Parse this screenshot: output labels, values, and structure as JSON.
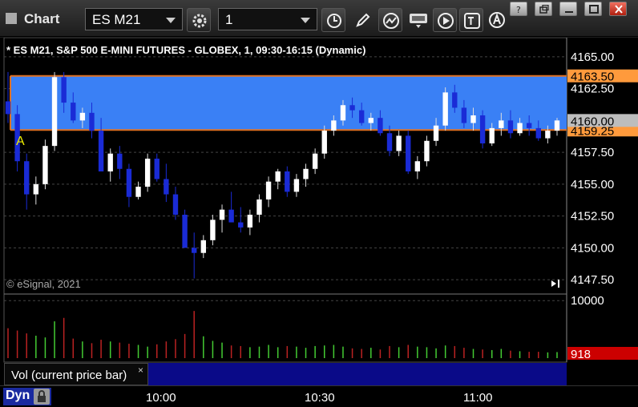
{
  "window": {
    "title": "Chart",
    "symbol": "ES M21",
    "interval": "1"
  },
  "chart": {
    "header": "* ES M21, S&P 500 E-MINI FUTURES - GLOBEX, 1, 09:30-16:15 (Dynamic)",
    "copyright": "© eSignal, 2021",
    "marker": "A",
    "price_axis": [
      "4165.00",
      "4162.50",
      "4157.50",
      "4155.00",
      "4152.50",
      "4150.00",
      "4147.50"
    ],
    "price_tags": {
      "upper": "4163.50",
      "last": "4160.00",
      "lower": "4159.25"
    },
    "volume_axis": "10000",
    "volume_tag": "918",
    "volume_study": "Vol (current price bar)",
    "volume_close": "×",
    "time_axis": [
      "10:00",
      "10:30",
      "11:00"
    ],
    "mode": "Dyn",
    "colors": {
      "up": "#ffffff",
      "down": "#1a2bd6",
      "band": "#3a80f5",
      "band_line": "#e07020",
      "tag": "#ff9a3c",
      "vol_up": "#44cc33",
      "vol_down": "#bb2222",
      "vol_tag": "#cc0000"
    }
  },
  "chart_data": {
    "type": "candlestick",
    "ylim": [
      4146.5,
      4166.5
    ],
    "band": [
      4159.25,
      4163.5
    ],
    "last": 4160.0,
    "candles": [
      [
        4161.5,
        4163.8,
        4159.8,
        4160.5
      ],
      [
        4160.5,
        4161.2,
        4156.0,
        4156.8
      ],
      [
        4156.8,
        4157.4,
        4153.0,
        4154.2
      ],
      [
        4154.2,
        4155.6,
        4153.4,
        4155.0
      ],
      [
        4155.0,
        4158.5,
        4154.6,
        4158.0
      ],
      [
        4158.0,
        4163.8,
        4157.6,
        4163.4
      ],
      [
        4163.4,
        4163.8,
        4160.6,
        4161.4
      ],
      [
        4161.4,
        4162.2,
        4159.8,
        4160.0
      ],
      [
        4160.0,
        4161.0,
        4159.4,
        4160.6
      ],
      [
        4160.6,
        4161.4,
        4158.6,
        4159.2
      ],
      [
        4159.2,
        4160.2,
        4156.4,
        4156.0
      ],
      [
        4156.0,
        4157.8,
        4155.2,
        4157.4
      ],
      [
        4157.4,
        4158.0,
        4155.4,
        4156.2
      ],
      [
        4156.2,
        4156.6,
        4153.2,
        4154.0
      ],
      [
        4154.0,
        4155.2,
        4153.8,
        4154.8
      ],
      [
        4154.8,
        4157.4,
        4154.4,
        4157.0
      ],
      [
        4157.0,
        4157.4,
        4155.2,
        4155.4
      ],
      [
        4155.4,
        4156.6,
        4153.6,
        4154.2
      ],
      [
        4154.2,
        4154.8,
        4152.2,
        4152.6
      ],
      [
        4152.6,
        4153.0,
        4150.4,
        4150.0
      ],
      [
        4150.0,
        4151.2,
        4147.6,
        4149.6
      ],
      [
        4149.6,
        4151.0,
        4149.2,
        4150.6
      ],
      [
        4150.6,
        4152.6,
        4150.2,
        4152.2
      ],
      [
        4152.2,
        4153.4,
        4151.2,
        4153.0
      ],
      [
        4153.0,
        4154.4,
        4152.6,
        4152.0
      ],
      [
        4152.0,
        4153.2,
        4151.2,
        4151.6
      ],
      [
        4151.6,
        4153.0,
        4151.0,
        4152.6
      ],
      [
        4152.6,
        4154.2,
        4152.0,
        4153.8
      ],
      [
        4153.8,
        4155.6,
        4153.2,
        4155.2
      ],
      [
        4155.2,
        4156.2,
        4154.6,
        4156.0
      ],
      [
        4156.0,
        4156.4,
        4154.0,
        4154.4
      ],
      [
        4154.4,
        4155.8,
        4154.0,
        4155.4
      ],
      [
        4155.4,
        4156.6,
        4154.8,
        4156.2
      ],
      [
        4156.2,
        4157.8,
        4155.8,
        4157.4
      ],
      [
        4157.4,
        4159.6,
        4157.0,
        4159.2
      ],
      [
        4159.2,
        4160.4,
        4158.8,
        4160.0
      ],
      [
        4160.0,
        4161.6,
        4159.6,
        4161.2
      ],
      [
        4161.2,
        4161.8,
        4160.2,
        4160.8
      ],
      [
        4160.8,
        4161.4,
        4159.6,
        4159.8
      ],
      [
        4159.8,
        4160.6,
        4159.2,
        4160.2
      ],
      [
        4160.2,
        4160.8,
        4158.8,
        4159.0
      ],
      [
        4159.0,
        4159.6,
        4157.2,
        4157.6
      ],
      [
        4157.6,
        4159.2,
        4157.2,
        4158.8
      ],
      [
        4158.8,
        4159.2,
        4155.8,
        4156.0
      ],
      [
        4156.0,
        4157.2,
        4155.4,
        4156.8
      ],
      [
        4156.8,
        4158.8,
        4156.4,
        4158.4
      ],
      [
        4158.4,
        4160.2,
        4158.0,
        4159.6
      ],
      [
        4159.6,
        4162.6,
        4159.2,
        4162.2
      ],
      [
        4162.2,
        4162.8,
        4160.6,
        4161.0
      ],
      [
        4161.0,
        4161.6,
        4159.4,
        4159.8
      ],
      [
        4159.8,
        4161.0,
        4159.2,
        4160.4
      ],
      [
        4160.4,
        4160.8,
        4157.8,
        4158.2
      ],
      [
        4158.2,
        4159.8,
        4158.0,
        4159.4
      ],
      [
        4159.4,
        4160.6,
        4158.8,
        4160.0
      ],
      [
        4160.0,
        4160.8,
        4158.6,
        4159.0
      ],
      [
        4159.0,
        4160.2,
        4158.8,
        4159.8
      ],
      [
        4159.8,
        4160.4,
        4158.8,
        4159.4
      ],
      [
        4159.4,
        4160.0,
        4158.4,
        4158.6
      ],
      [
        4158.6,
        4159.6,
        4158.2,
        4159.2
      ],
      [
        4159.2,
        4160.2,
        4158.8,
        4160.0
      ]
    ],
    "volumes": [
      5200,
      4800,
      4300,
      3900,
      3600,
      6400,
      7000,
      3400,
      2900,
      2600,
      3200,
      2900,
      2700,
      2500,
      2300,
      2000,
      2400,
      2900,
      3300,
      4200,
      8200,
      3800,
      3000,
      2700,
      2200,
      2100,
      1900,
      2000,
      2300,
      1900,
      2100,
      2000,
      1800,
      2100,
      2200,
      2300,
      2000,
      1700,
      1600,
      1800,
      1500,
      2100,
      1900,
      2300,
      2000,
      1900,
      1700,
      2200,
      2100,
      1800,
      1600,
      1500,
      1400,
      1600,
      1300,
      1200,
      1100,
      1100,
      1000,
      1050
    ]
  }
}
